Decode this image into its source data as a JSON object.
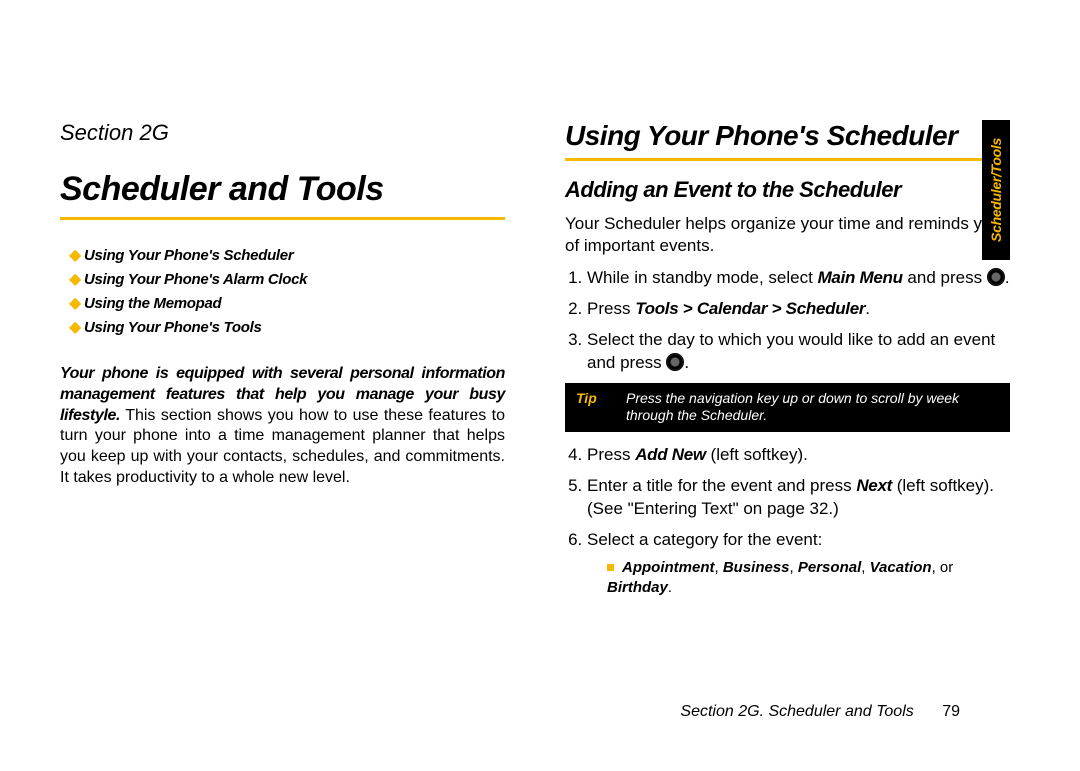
{
  "left": {
    "section_label": "Section 2G",
    "title": "Scheduler and Tools",
    "toc": [
      "Using Your Phone's Scheduler",
      "Using Your Phone's Alarm Clock",
      "Using the Memopad",
      "Using Your Phone's Tools"
    ],
    "intro_lead": "Your phone is equipped with several personal information management features that help you manage your busy lifestyle.",
    "intro_rest": " This section shows you how to use these features to turn your phone into a time management planner that helps you keep up with your contacts, schedules, and commitments. It takes productivity to a whole new level."
  },
  "right": {
    "h1": "Using Your Phone's Scheduler",
    "h2": "Adding an Event to the Scheduler",
    "body1": "Your Scheduler helps organize your time and reminds you of important events.",
    "step1_a": "While in standby mode, select ",
    "step1_b": "Main Menu",
    "step1_c": " and press ",
    "step1_d": ".",
    "step2_a": "Press ",
    "step2_b": "Tools > Calendar > Scheduler",
    "step2_c": ".",
    "step3_a": "Select the day to which you would like to add an event and press ",
    "step3_b": ".",
    "tip_label": "Tip",
    "tip_body": "Press the navigation key up or down to scroll by week through the Scheduler.",
    "step4_a": "Press ",
    "step4_b": "Add New",
    "step4_c": " (left softkey).",
    "step5_a": "Enter a title for the event and press ",
    "step5_b": "Next",
    "step5_c": " (left softkey). (See \"Entering Text\" on page 32.)",
    "step6": "Select a category for the event:",
    "categories": [
      "Appointment",
      "Business",
      "Personal",
      "Vacation",
      "Birthday"
    ],
    "cat_or": " or "
  },
  "footer": {
    "text": "Section 2G. Scheduler and Tools",
    "page": "79"
  },
  "sidetab": "Scheduler/Tools"
}
